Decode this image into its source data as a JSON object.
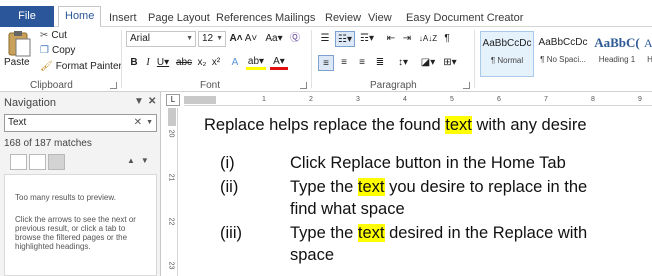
{
  "tabs": [
    {
      "label": "File"
    },
    {
      "label": "Home"
    },
    {
      "label": "Insert"
    },
    {
      "label": "Page Layout"
    },
    {
      "label": "References"
    },
    {
      "label": "Mailings"
    },
    {
      "label": "Review"
    },
    {
      "label": "View"
    },
    {
      "label": "Easy Document Creator"
    }
  ],
  "ribbon": {
    "clipboard": {
      "paste": "Paste",
      "cut": "Cut",
      "copy": "Copy",
      "format_painter": "Format Painter",
      "label": "Clipboard"
    },
    "font": {
      "name": "Arial",
      "size": "12",
      "grow": "A˄",
      "shrink": "A˅",
      "case": "Aa▾",
      "clear": "Ⓠ",
      "label": "Font"
    },
    "paragraph": {
      "label": "Paragraph",
      "sort": "↓A↓Z",
      "pilcrow": "¶"
    },
    "styles": [
      {
        "sample": "AaBbCcDc",
        "name": "¶ Normal"
      },
      {
        "sample": "AaBbCcDc",
        "name": "¶ No Spaci..."
      },
      {
        "sample": "AaBbC(",
        "name": "Heading 1"
      },
      {
        "sample": "AaB",
        "name": "H"
      }
    ]
  },
  "navigation": {
    "title": "Navigation",
    "search_value": "Text",
    "match_count": "168 of 187 matches",
    "message1": "Too many results to preview.",
    "message2": "Click the arrows to see the next or previous result, or click a tab to browse the filtered pages or the highlighted headings."
  },
  "ruler": {
    "corner": "L",
    "marks": [
      "1",
      "2",
      "3",
      "4",
      "5",
      "6",
      "7",
      "8",
      "9"
    ],
    "vmarks": [
      "20",
      "21",
      "22",
      "23"
    ]
  },
  "document": {
    "intro_before": "Replace helps replace the found ",
    "intro_hl": "text",
    "intro_after": " with any desire",
    "items": [
      {
        "num": "(i)",
        "text": "Click Replace button in the Home Tab"
      },
      {
        "num": "(ii)",
        "before": "Type the ",
        "hl": "text",
        "after": " you desire to replace in the",
        "cont": "find what space"
      },
      {
        "num": "(iii)",
        "before": "Type the ",
        "hl": "text",
        "after": " desired in the Replace with",
        "cont": "space"
      }
    ]
  },
  "colors": {
    "file_tab": "#2b579a",
    "highlight": "#ffff00"
  }
}
